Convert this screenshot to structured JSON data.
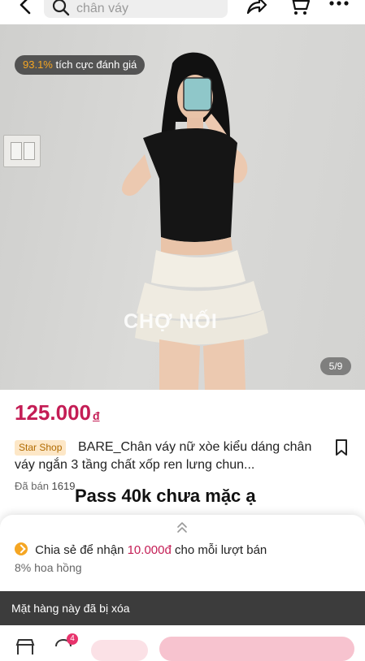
{
  "search": {
    "value": "chân váy"
  },
  "photo": {
    "rating_pct": "93.1%",
    "rating_text": "tích cực đánh giá",
    "watermark": "CHỢ NỐI",
    "counter": "5/9"
  },
  "product": {
    "price": "125.000",
    "currency": "đ",
    "shop_badge": "Star Shop",
    "title": "BARE_Chân váy nữ xòe kiểu dáng chân váy ngắn 3 tầng chất xốp ren lưng chun...",
    "sold_label": "Đã bán",
    "sold_count": "1619",
    "overlay_text": "Pass 40k chưa mặc ạ"
  },
  "sheet": {
    "share_prefix": "Chia sẻ để nhận",
    "share_amount": "10.000đ",
    "share_suffix": "cho mỗi lượt bán",
    "commission": "8% hoa hồng"
  },
  "toast": "Mặt hàng này đã bị xóa",
  "bottom": {
    "chat_badge": "4"
  },
  "colors": {
    "price": "#c41d55",
    "accent": "#f7c3cf",
    "rating": "#f5a623",
    "toast_bg": "#3c3c3c"
  }
}
